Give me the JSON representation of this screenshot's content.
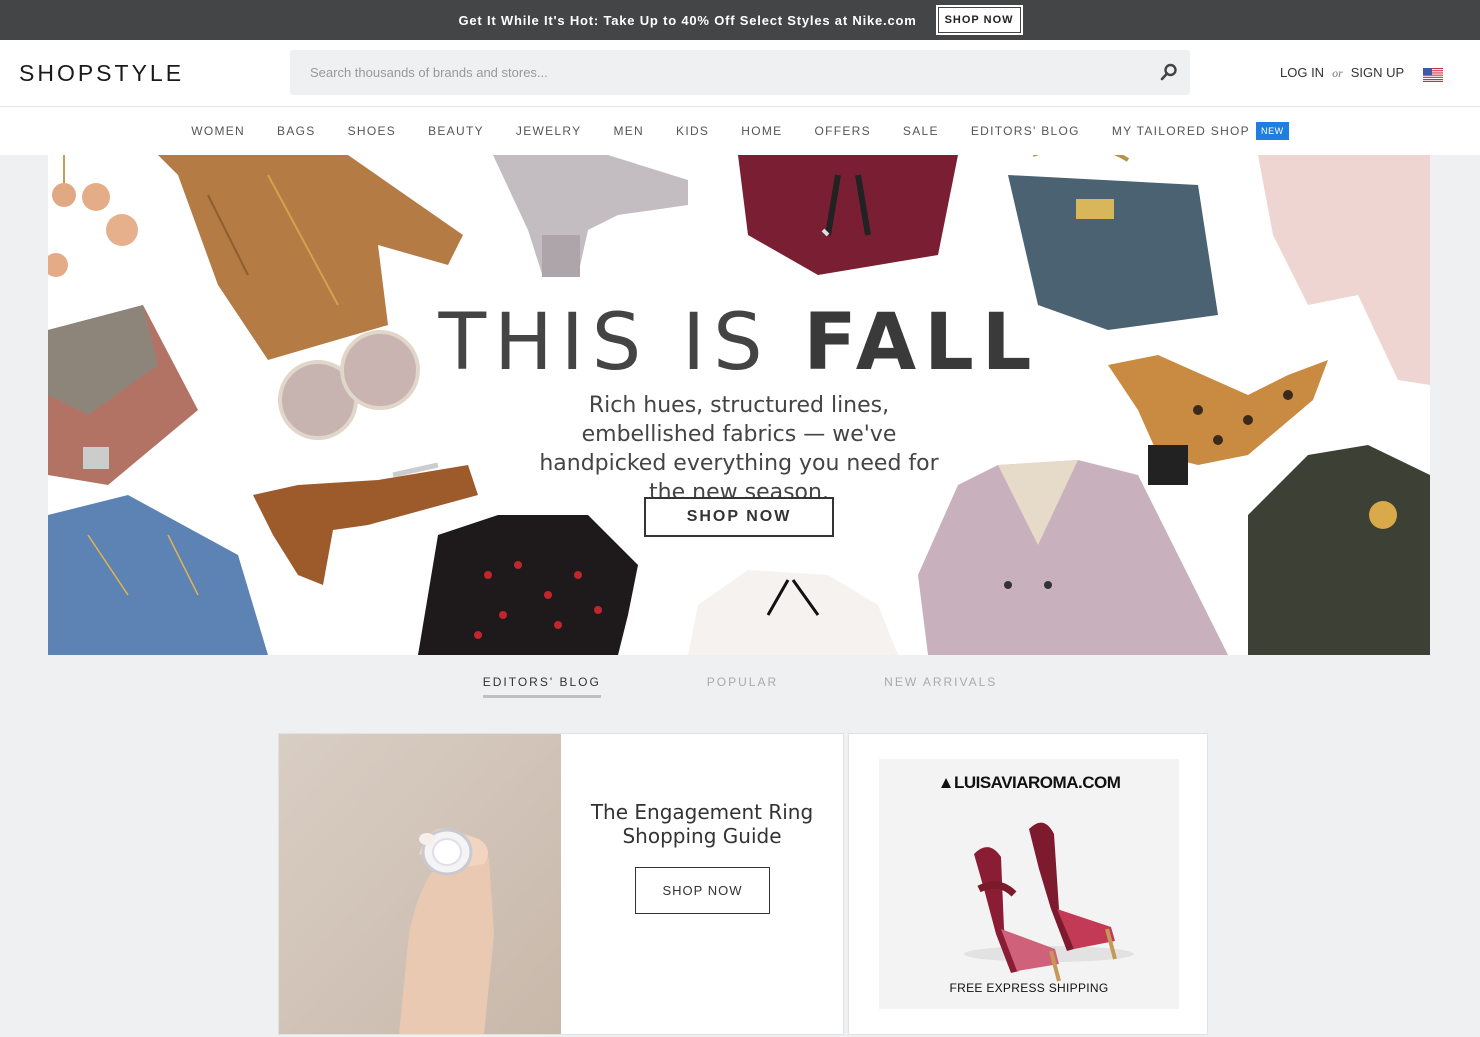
{
  "promo": {
    "text": "Get It While It's Hot: Take Up to 40% Off Select Styles at Nike.com",
    "button": "SHOP NOW"
  },
  "header": {
    "logo": "SHOPSTYLE",
    "search_placeholder": "Search thousands of brands and stores...",
    "login": "LOG IN",
    "or": "or",
    "signup": "SIGN UP",
    "region_icon": "us-flag-icon"
  },
  "nav": {
    "items": [
      "WOMEN",
      "BAGS",
      "SHOES",
      "BEAUTY",
      "JEWELRY",
      "MEN",
      "KIDS",
      "HOME",
      "OFFERS",
      "SALE",
      "EDITORS' BLOG",
      "MY TAILORED SHOP"
    ],
    "new_badge": "NEW"
  },
  "hero": {
    "title_light": "THIS IS",
    "title_bold": "FALL",
    "subtitle": "Rich hues, structured lines, embellished fabrics — we've handpicked everything you need for the new season.",
    "button": "SHOP NOW"
  },
  "tabs": {
    "items": [
      "EDITORS' BLOG",
      "POPULAR",
      "NEW ARRIVALS"
    ],
    "active": "EDITORS' BLOG"
  },
  "feature_card": {
    "title": "The Engagement Ring Shopping Guide",
    "button": "SHOP NOW"
  },
  "ad": {
    "brand": "▲LUISAVIAROMA.COM",
    "footer": "FREE EXPRESS SHIPPING"
  },
  "colors": {
    "promo_bg": "#444546",
    "page_bg": "#eff0f2",
    "new_badge": "#1e7fe0"
  }
}
